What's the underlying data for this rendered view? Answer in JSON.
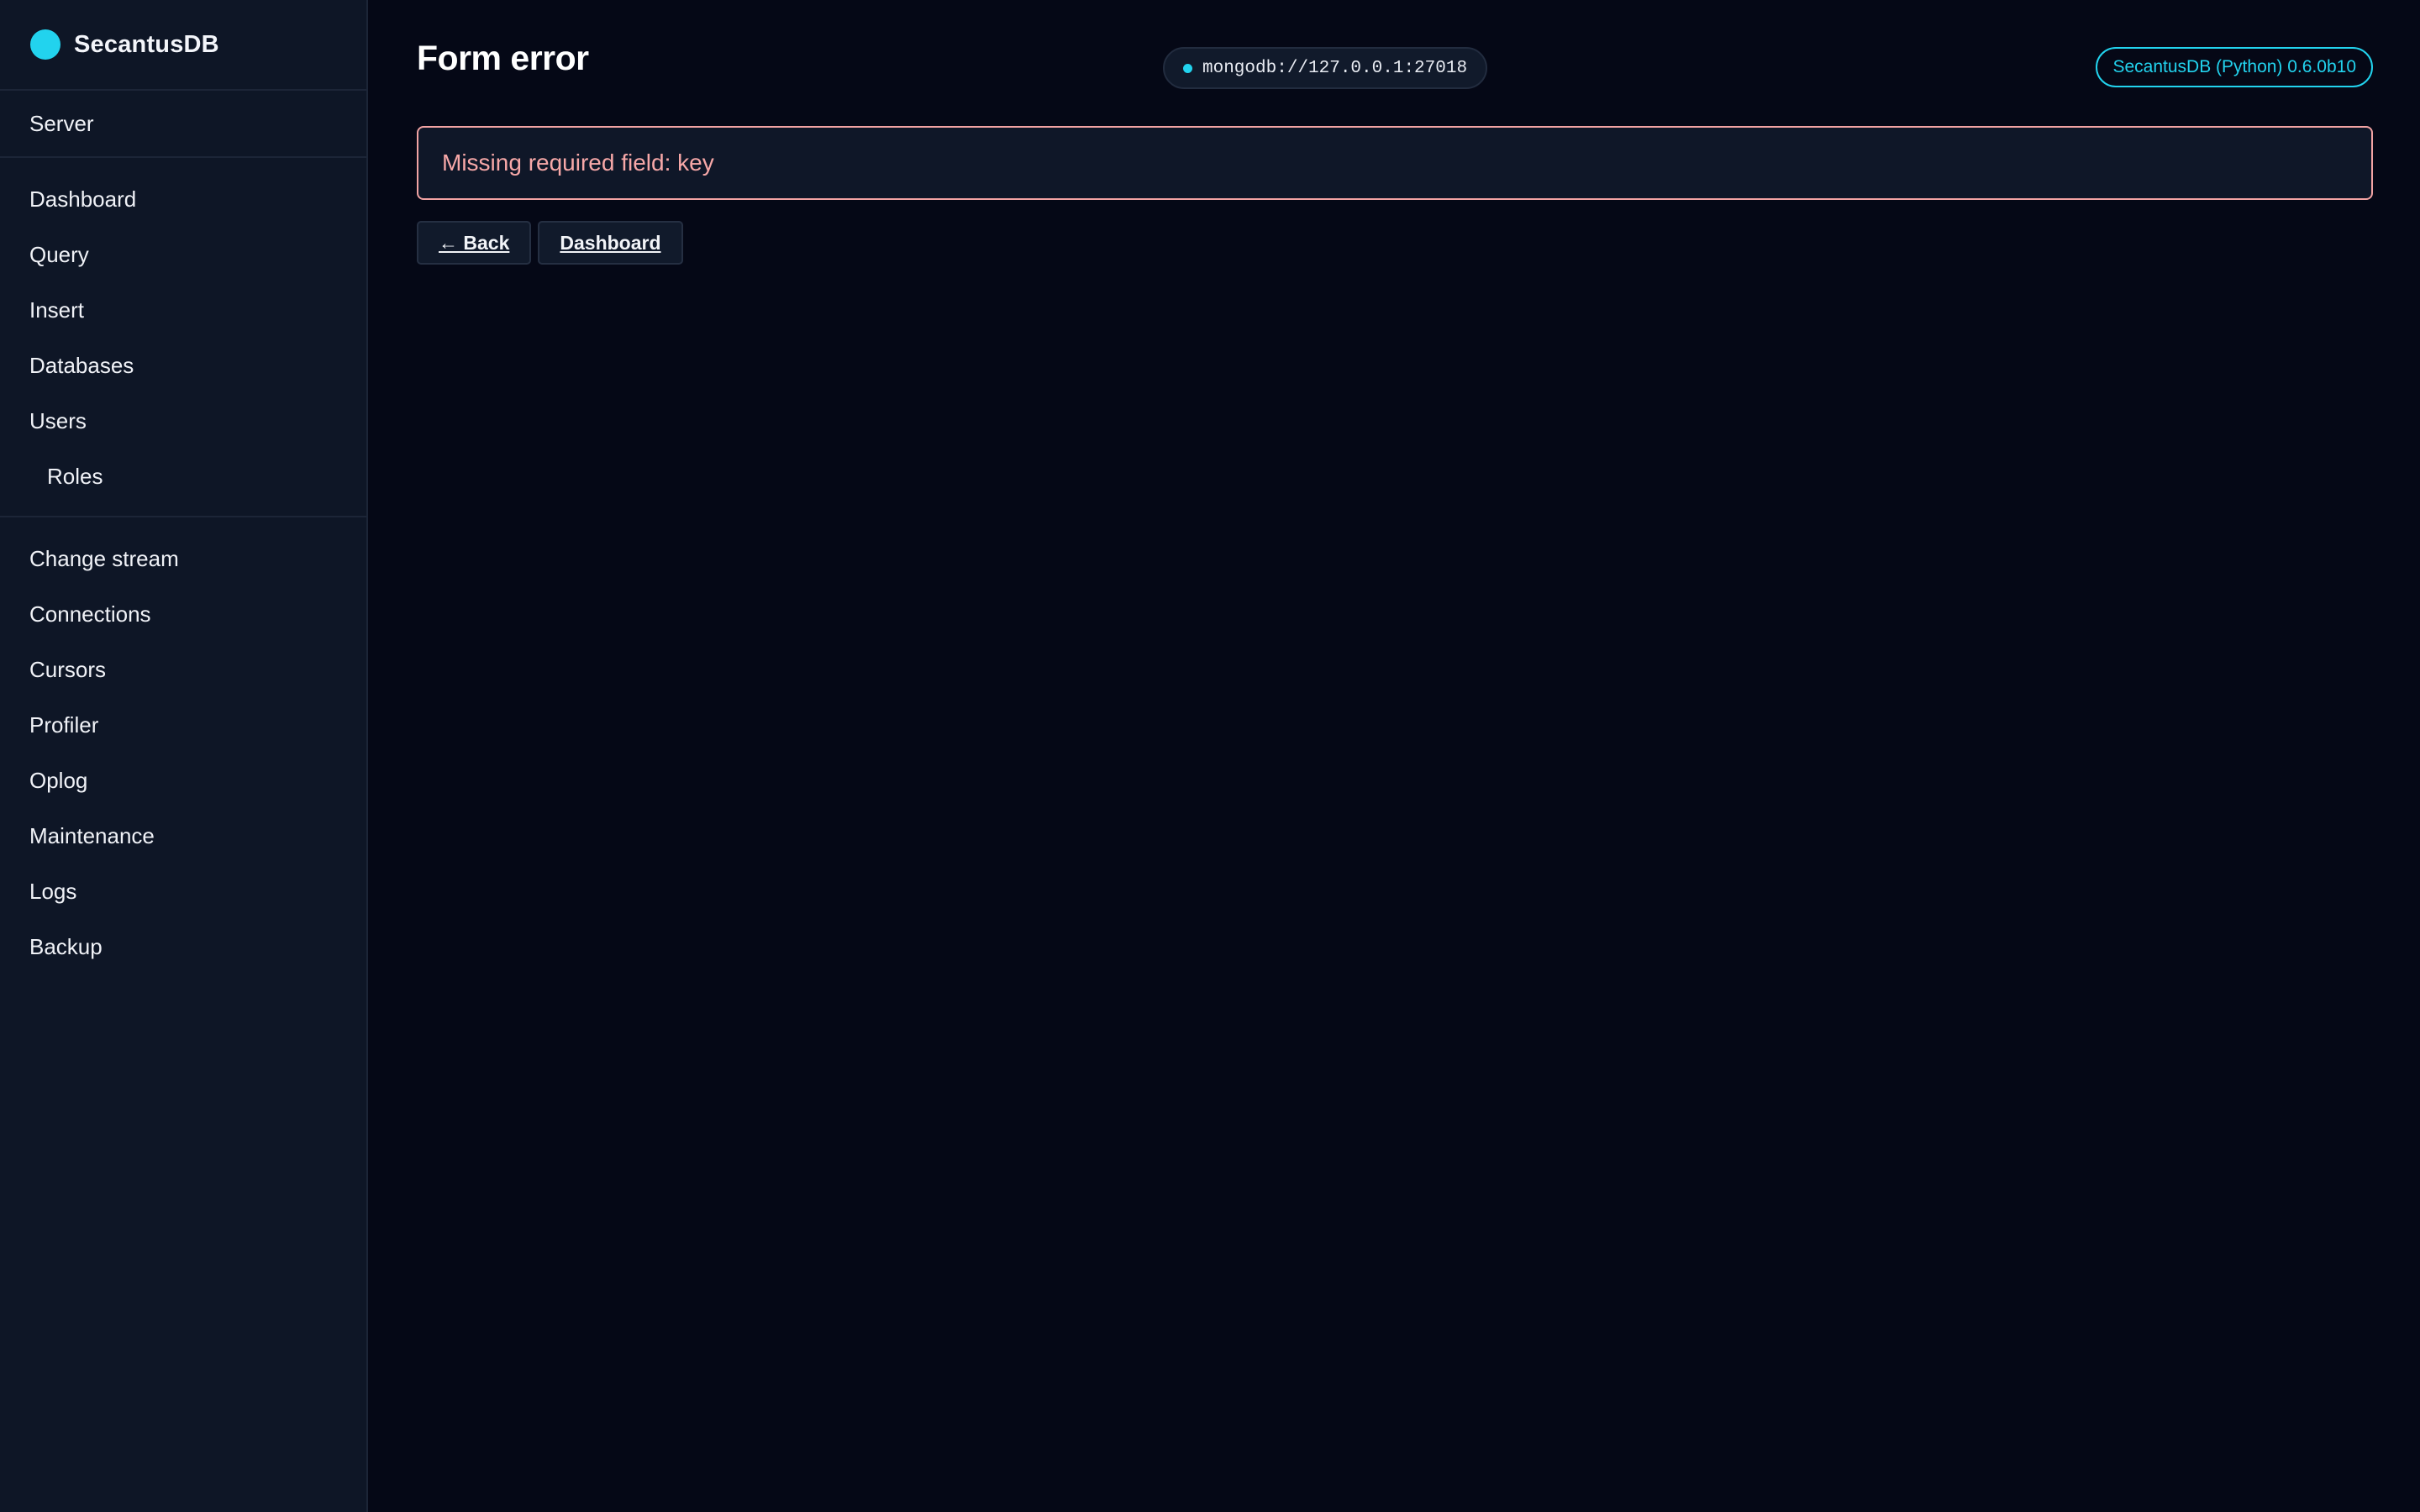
{
  "brand": {
    "name": "SecantusDB",
    "accent": "#22d3ee"
  },
  "sidebar": {
    "server_group": [
      {
        "label": "Server"
      }
    ],
    "main_group": [
      {
        "label": "Dashboard"
      },
      {
        "label": "Query"
      },
      {
        "label": "Insert"
      },
      {
        "label": "Databases"
      },
      {
        "label": "Users"
      },
      {
        "label": "Roles"
      }
    ],
    "tools_group": [
      {
        "label": "Change stream"
      },
      {
        "label": "Connections"
      },
      {
        "label": "Cursors"
      },
      {
        "label": "Profiler"
      },
      {
        "label": "Oplog"
      },
      {
        "label": "Maintenance"
      },
      {
        "label": "Logs"
      },
      {
        "label": "Backup"
      }
    ]
  },
  "header": {
    "title": "Form error",
    "connection": "mongodb://127.0.0.1:27018",
    "version": "SecantusDB (Python) 0.6.0b10"
  },
  "error": {
    "message": "Missing required field: key",
    "color": "#f7a8a8"
  },
  "actions": {
    "back_label": "← Back",
    "dashboard_label": "Dashboard"
  }
}
